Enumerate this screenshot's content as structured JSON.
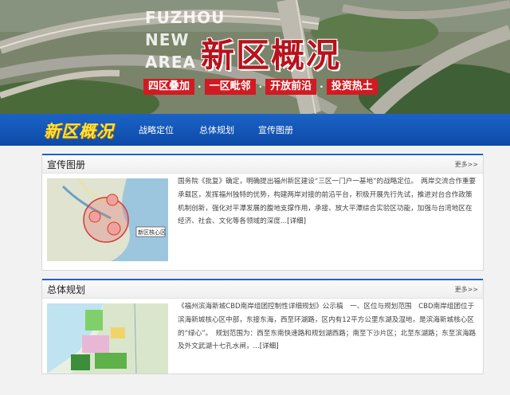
{
  "banner": {
    "en_line1": "FUZHOU",
    "en_line2": "NEW",
    "en_line3": "AREA",
    "title": "新区概况",
    "slogan": [
      "四区叠加",
      "一区毗邻",
      "开放前沿",
      "投资热土"
    ],
    "slogan_sep": "·"
  },
  "nav": {
    "logo": "新区概况",
    "items": [
      "战略定位",
      "总体规划",
      "宣传图册"
    ]
  },
  "panels": [
    {
      "title": "宣传图册",
      "more": "更多>>",
      "text": "国务院《批复》确定，明确提出福州新区建设“三区一门户一基地”的战略定位。　两岸交流合作重要承载区，发挥福州独特的优势，构建两岸对接的前沿平台，积极开展先行先试，推进对台合作政策机制创新，强化对平潭发展的腹地支撑作用，承接、放大平潭综合实验区功能，加强与台湾地区在经济、社会、文化等各领域的深度...",
      "link": "[详细]",
      "map_label": "新区核心区"
    },
    {
      "title": "总体规划",
      "more": "更多>>",
      "text": "《福州滨海新城CBD南岸组团控制性详细规划》公示稿　一、区位与规划范围　CBD南岸组团位于滨海新城核心区中部，东接东海，西至环湖路，区内有12平方公里东湖及湿地，是滨海新城核心区的“绿心”。　规划范围为：西至东南快速路和规划湖西路；南至下沙片区；北至东湖路；东至滨海路及外文武湖十七孔水闸，...",
      "link": "[详细]"
    }
  ],
  "colors": {
    "nav_blue": "#1b63c6",
    "title_red": "#b8121c",
    "slogan_red": "#d21a22",
    "logo_yellow": "#ffe23a"
  }
}
